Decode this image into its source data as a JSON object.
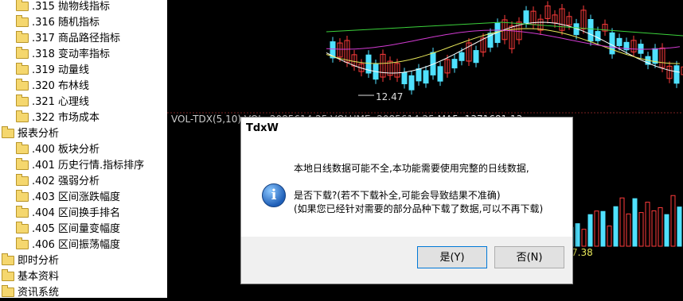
{
  "tree": {
    "items": [
      {
        "code": ".315",
        "label": "抛物线指标"
      },
      {
        "code": ".316",
        "label": "随机指标"
      },
      {
        "code": ".317",
        "label": "商品路径指标"
      },
      {
        "code": ".318",
        "label": "变动率指标"
      },
      {
        "code": ".319",
        "label": "动量线"
      },
      {
        "code": ".320",
        "label": "布林线"
      },
      {
        "code": ".321",
        "label": "心理线"
      },
      {
        "code": ".322",
        "label": "市场成本"
      }
    ],
    "group_report": "报表分析",
    "report_items": [
      {
        "code": ".400",
        "label": "板块分析"
      },
      {
        "code": ".401",
        "label": "历史行情.指标排序"
      },
      {
        "code": ".402",
        "label": "强弱分析"
      },
      {
        "code": ".403",
        "label": "区间涨跌幅度"
      },
      {
        "code": ".404",
        "label": "区间换手排名"
      },
      {
        "code": ".405",
        "label": "区间量变幅度"
      },
      {
        "code": ".406",
        "label": "区间振荡幅度"
      }
    ],
    "group_realtime": "即时分析",
    "group_basic": "基本资料",
    "group_news": "资讯系统"
  },
  "chart": {
    "low_label": "12.47",
    "info_text": "VOL-TDX(5,10) VOL: 2085614.25  VOLUME: 2085614.25",
    "ma5_text": "MA5: 1371681.13",
    "vol_label": "7.38"
  },
  "dialog": {
    "title": "TdxW",
    "line1": "本地日线数据可能不全,本功能需要使用完整的日线数据,",
    "line2": "是否下载?(若不下载补全,可能会导致结果不准确)",
    "line3": "(如果您已经针对需要的部分品种下载了数据,可以不再下载)",
    "yes_label": "是(Y)",
    "no_label": "否(N)",
    "icon": "info-icon"
  },
  "colors": {
    "up": "#ff3b3b",
    "down": "#4fe1ff",
    "ma_white": "#ffffff",
    "ma_yellow": "#e8e85a",
    "ma_magenta": "#d23bd2",
    "ma_green": "#3bd23b"
  }
}
